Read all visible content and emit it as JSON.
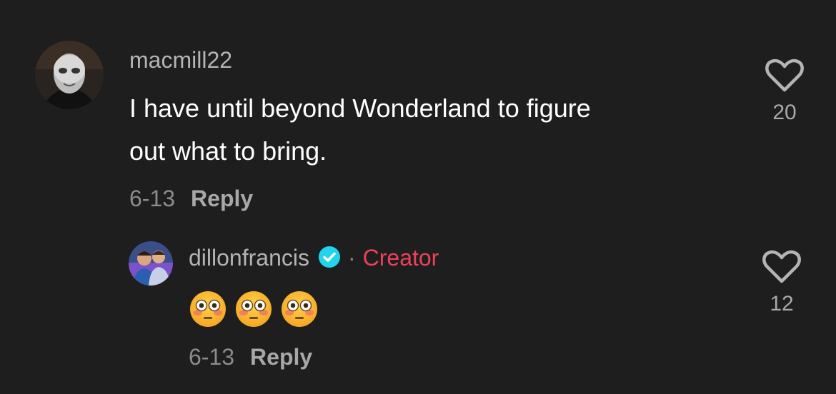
{
  "comments": [
    {
      "username": "macmill22",
      "text_line1": "I have until beyond Wonderland to figure",
      "text_line2": "out what to bring.",
      "date": "6-13",
      "reply_label": "Reply",
      "likes": "20",
      "avatar_icon": "masked-person-avatar"
    },
    {
      "username": "dillonfrancis",
      "badge_icon": "verified-check-icon",
      "separator": "·",
      "creator_label": "Creator",
      "emojis": [
        "flushed-face-emoji",
        "flushed-face-emoji",
        "flushed-face-emoji"
      ],
      "date": "6-13",
      "reply_label": "Reply",
      "likes": "12",
      "avatar_icon": "two-people-avatar"
    }
  ],
  "colors": {
    "background": "#1e1e1e",
    "creator": "#ea4359",
    "verified": "#20d5ec",
    "muted": "#8c8c8c"
  }
}
